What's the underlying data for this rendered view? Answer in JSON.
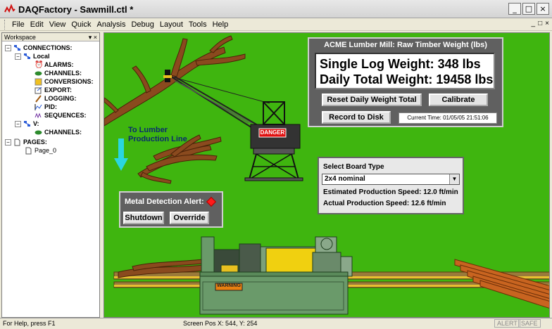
{
  "window": {
    "title": "DAQFactory - Sawmill.ctl *",
    "controls": [
      "_",
      "□",
      "×"
    ]
  },
  "menu": {
    "items": [
      "File",
      "Edit",
      "View",
      "Quick",
      "Analysis",
      "Debug",
      "Layout",
      "Tools",
      "Help"
    ],
    "mdi_controls": [
      "_",
      "□",
      "×"
    ]
  },
  "workspace": {
    "title": "Workspace",
    "controls": "▾ ×",
    "tree": {
      "connections": "CONNECTIONS:",
      "local": "Local",
      "alarms": "ALARMS:",
      "channels": "CHANNELS:",
      "conversions": "CONVERSIONS:",
      "export": "EXPORT:",
      "logging": "LOGGING:",
      "pid": "PID:",
      "sequences": "SEQUENCES:",
      "v": "V:",
      "v_channels": "CHANNELS:",
      "pages": "PAGES:",
      "page0": "Page_0"
    }
  },
  "weight_panel": {
    "title": "ACME Lumber Mill: Raw Timber Weight (lbs)",
    "single_log": "Single Log Weight: 348 lbs",
    "daily_total": "Daily Total Weight: 19458 lbs",
    "reset_label": "Reset Daily Weight Total",
    "calibrate_label": "Calibrate",
    "record_label": "Record to Disk",
    "current_time": "Current Time: 01/05/05 21:51:06"
  },
  "board_panel": {
    "title": "Select Board Type",
    "selected": "2x4 nominal",
    "estimated": "Estimated Production Speed: 12.0 ft/min",
    "actual": "Actual Production Speed: 12.6 ft/min"
  },
  "metal_panel": {
    "title": "Metal Detection Alert:",
    "shutdown_label": "Shutdown",
    "override_label": "Override"
  },
  "scene": {
    "production_line_label_1": "To Lumber",
    "production_line_label_2": "Production Line",
    "danger_sign": "DANGER",
    "warning_sign": "WARNING"
  },
  "status": {
    "help": "For Help, press F1",
    "screen_pos": "Screen Pos X: 544, Y: 254",
    "alert": "ALERT",
    "safe": "SAFE"
  },
  "colors": {
    "canvas": "#3fb50f",
    "panel": "#606060",
    "alert_diamond": "#ff1a1a",
    "arrow": "#2ad6e0"
  }
}
